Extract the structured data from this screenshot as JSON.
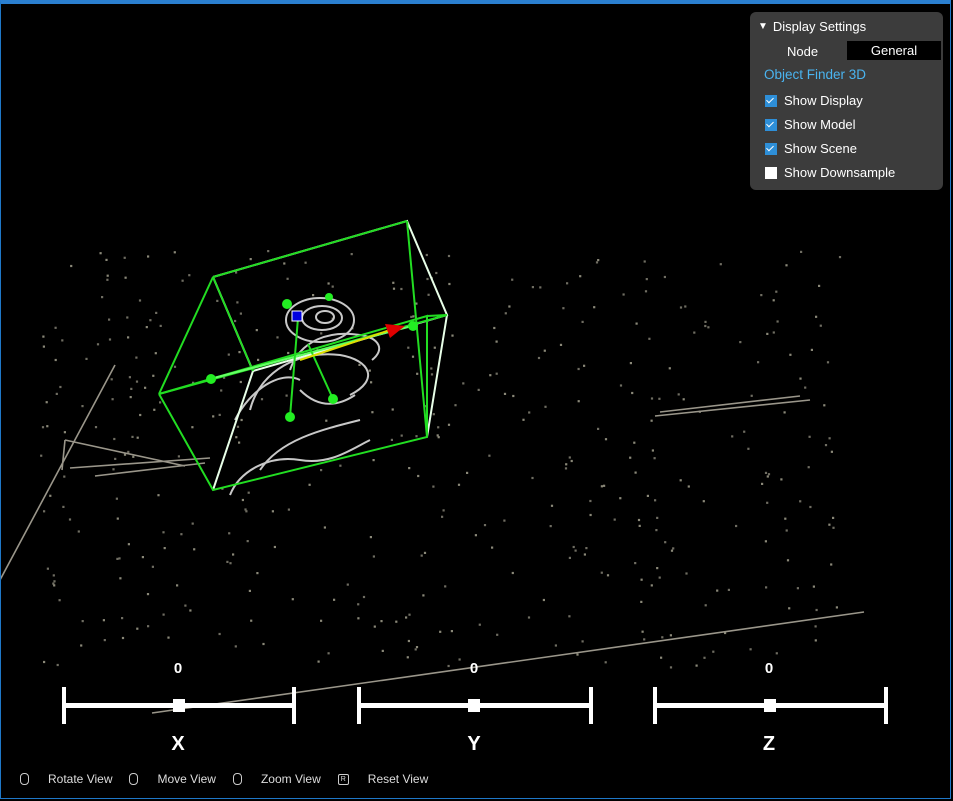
{
  "panel": {
    "title": "Display Settings",
    "node_label": "Node",
    "node_value": "General",
    "section": "Object Finder 3D",
    "checkboxes": [
      {
        "label": "Show Display",
        "checked": true
      },
      {
        "label": "Show Model",
        "checked": true
      },
      {
        "label": "Show Scene",
        "checked": true
      },
      {
        "label": "Show Downsample",
        "checked": false
      }
    ]
  },
  "axes": [
    {
      "name": "X",
      "value": "0"
    },
    {
      "name": "Y",
      "value": "0"
    },
    {
      "name": "Z",
      "value": "0"
    }
  ],
  "hints": [
    {
      "icon": "mouse-left-icon",
      "label": "Rotate View"
    },
    {
      "icon": "mouse-right-icon",
      "label": "Move View"
    },
    {
      "icon": "mouse-wheel-icon",
      "label": "Zoom View"
    },
    {
      "icon": "key-r-icon",
      "label": "Reset View"
    }
  ],
  "colors": {
    "background": "#000000",
    "bbox": "#22dd22",
    "accent": "#4ab4f0"
  }
}
